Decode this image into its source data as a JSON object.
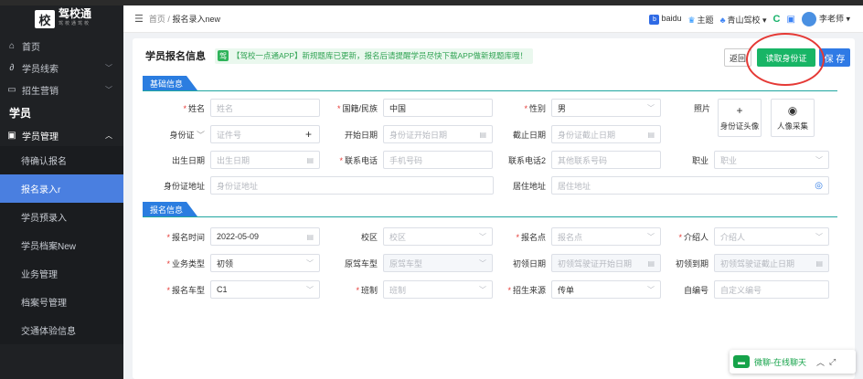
{
  "sidebar": {
    "logo_badge": "校",
    "logo_text": "驾校通",
    "logo_sub": "驾校通驾校",
    "items": [
      {
        "icon": "home-icon",
        "glyph": "⌂",
        "label": "首页"
      },
      {
        "icon": "lead-icon",
        "glyph": "∂",
        "label": "学员线索"
      },
      {
        "icon": "recruit-icon",
        "glyph": "▭",
        "label": "招生营销"
      }
    ],
    "group_label": "学员",
    "mgmt": {
      "glyph": "▣",
      "label": "学员管理"
    },
    "sub_items": [
      "待确认报名",
      "报名录入r",
      "学员预录入",
      "学员档案New",
      "业务管理",
      "档案号管理",
      "交通体验信息"
    ]
  },
  "header": {
    "breadcrumb_home": "首页",
    "breadcrumb_sep": "/",
    "breadcrumb_current": "报名录入new",
    "baidu": "baidu",
    "theme": "主题",
    "school": "青山驾校",
    "user": "李老师"
  },
  "form": {
    "title": "学员报名信息",
    "notice_tag": "驾",
    "notice": "【驾校一点通APP】新规题库已更新，报名后请提醒学员尽快下载APP做新规题库哦！",
    "back_label": "返回",
    "read_id_label": "读取身份证",
    "save_label": "保 存",
    "section1": "基础信息",
    "section2": "报名信息",
    "photo_label": "照片",
    "id_photo_label": "身份证头像",
    "face_capture_label": "人像采集",
    "fields": {
      "name": {
        "label": "姓名",
        "placeholder": "姓名"
      },
      "nationality": {
        "label": "国籍/民族",
        "value": "中国"
      },
      "gender": {
        "label": "性别",
        "value": "男"
      },
      "id_type": {
        "label": "身份证"
      },
      "id_no": {
        "placeholder": "证件号"
      },
      "start_date": {
        "label": "开始日期",
        "placeholder": "身份证开始日期"
      },
      "end_date": {
        "label": "截止日期",
        "placeholder": "身份证截止日期"
      },
      "birth": {
        "label": "出生日期",
        "placeholder": "出生日期"
      },
      "phone": {
        "label": "联系电话",
        "placeholder": "手机号码"
      },
      "phone2": {
        "label": "联系电话2",
        "placeholder": "其他联系号码"
      },
      "job": {
        "label": "职业",
        "placeholder": "职业"
      },
      "id_addr": {
        "label": "身份证地址",
        "placeholder": "身份证地址"
      },
      "home_addr": {
        "label": "居住地址",
        "placeholder": "居住地址"
      },
      "reg_time": {
        "label": "报名时间",
        "value": "2022-05-09"
      },
      "campus": {
        "label": "校区",
        "placeholder": "校区"
      },
      "reg_point": {
        "label": "报名点",
        "placeholder": "报名点"
      },
      "referrer": {
        "label": "介绍人",
        "placeholder": "介绍人"
      },
      "biz_type": {
        "label": "业务类型",
        "value": "初领"
      },
      "orig_car": {
        "label": "原驾车型",
        "placeholder": "原驾车型"
      },
      "first_date": {
        "label": "初领日期",
        "placeholder": "初领驾驶证开始日期"
      },
      "first_expire": {
        "label": "初领到期",
        "placeholder": "初领驾驶证截止日期"
      },
      "reg_car": {
        "label": "报名车型",
        "value": "C1"
      },
      "class": {
        "label": "班制",
        "placeholder": "班制"
      },
      "source": {
        "label": "招生来源",
        "value": "传单"
      },
      "custom_no": {
        "label": "自编号",
        "placeholder": "自定义编号"
      }
    }
  },
  "chat": {
    "label": "微聊-在线聊天"
  },
  "colors": {
    "primary": "#2f7ae5",
    "green": "#18b566",
    "sidebar": "#1f2124",
    "highlight": "#e53935"
  }
}
